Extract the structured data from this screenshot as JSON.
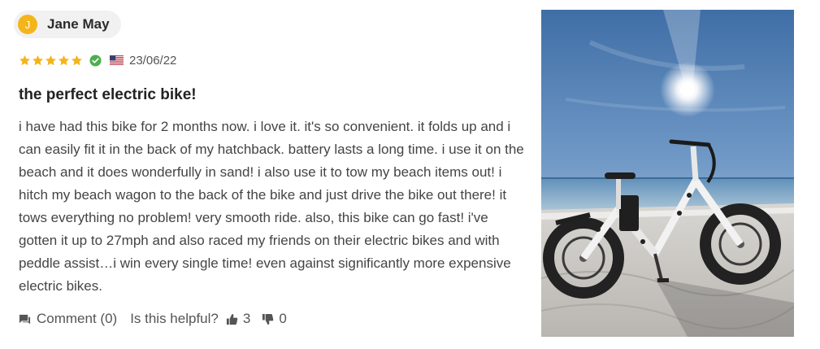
{
  "review": {
    "author": {
      "initial": "J",
      "name": "Jane May"
    },
    "rating": 5,
    "verified_icon": "check-circle-icon",
    "country_flag": "us-flag-icon",
    "date": "23/06/22",
    "title": "the perfect electric bike!",
    "body": "i have had this bike for 2 months now. i love it. it's so convenient. it folds up and i can easily fit it in the back of my hatchback. battery lasts a long time. i use it on the beach and it does wonderfully in sand! i also use it to tow my beach items out! i hitch my beach wagon to the back of the bike and just drive the bike out there! it tows everything no problem! very smooth ride. also, this bike can go fast! i've gotten it up to 27mph and also raced my friends on their electric bikes and with peddle assist…i win every single time! even against significantly more expensive electric bikes.",
    "actions": {
      "comment_label": "Comment (0)",
      "helpful_label": "Is this helpful?",
      "helpful_up_count": "3",
      "helpful_down_count": "0"
    },
    "colors": {
      "avatar": "#f4b51c",
      "star": "#f4b51c",
      "verified": "#4caf50",
      "pill": "#f1f1f1"
    }
  }
}
